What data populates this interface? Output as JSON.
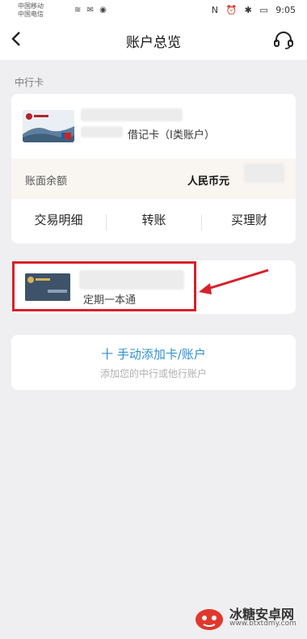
{
  "status_bar": {
    "carrier_1": "中国移动",
    "carrier_2": "中国电信",
    "time": "9:05"
  },
  "header": {
    "title": "账户总览"
  },
  "section": {
    "label": "中行卡"
  },
  "debit_card": {
    "account_type": "借记卡（I类账户）",
    "balance_label": "账面余额",
    "currency": "人民币元",
    "actions": [
      "交易明细",
      "转账",
      "买理财"
    ]
  },
  "fixed_card": {
    "label": "定期一本通"
  },
  "add_card": {
    "title": "十 手动添加卡/账户",
    "subtitle": "添加您的中行或他行账户"
  },
  "watermark": {
    "brand": "冰糖安卓网",
    "url": "www.btxtdmy.com"
  },
  "colors": {
    "accent": "#2f8fd0",
    "highlight": "#d8202a",
    "balance_bg": "#f9f5f1"
  }
}
